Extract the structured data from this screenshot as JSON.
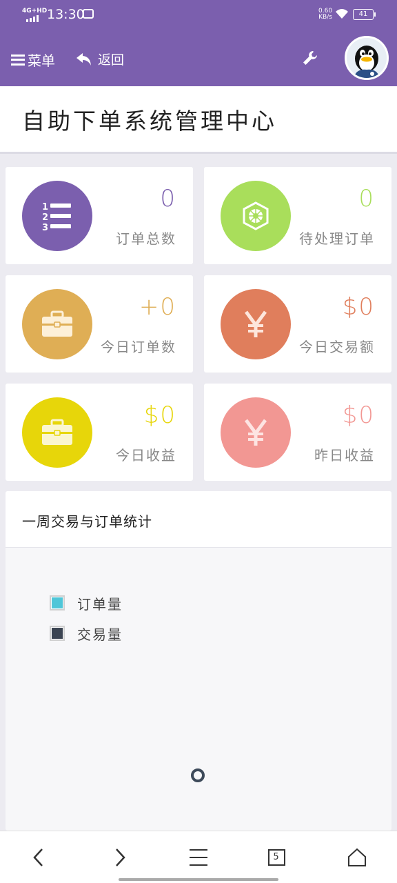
{
  "status_bar": {
    "network": "4G+HD",
    "time": "13:30",
    "speed_value": "0.60",
    "speed_unit": "KB/s",
    "battery": "41"
  },
  "nav": {
    "menu_label": "菜单",
    "back_label": "返回"
  },
  "page": {
    "title": "自助下单系统管理中心"
  },
  "cards": [
    {
      "value": "0",
      "label": "订单总数",
      "color": "#7b5fae",
      "icon": "numbered-list-icon"
    },
    {
      "value": "0",
      "label": "待处理订单",
      "color": "#a9de5b",
      "icon": "hexagon-emblem-icon"
    },
    {
      "value": "+0",
      "label": "今日订单数",
      "color": "#dfae55",
      "icon": "briefcase-icon"
    },
    {
      "value": "$0",
      "label": "今日交易额",
      "color": "#e07e5c",
      "icon": "yen-icon"
    },
    {
      "value": "$0",
      "label": "今日收益",
      "color": "#e7d60a",
      "icon": "briefcase-icon"
    },
    {
      "value": "$0",
      "label": "昨日收益",
      "color": "#f29793",
      "icon": "yen-icon"
    }
  ],
  "weekly_stats": {
    "title": "一周交易与订单统计",
    "legend": [
      {
        "label": "订单量",
        "color": "#4fc6d8"
      },
      {
        "label": "交易量",
        "color": "#3b4452"
      }
    ]
  },
  "bottom_nav": {
    "tab_count": "5"
  }
}
